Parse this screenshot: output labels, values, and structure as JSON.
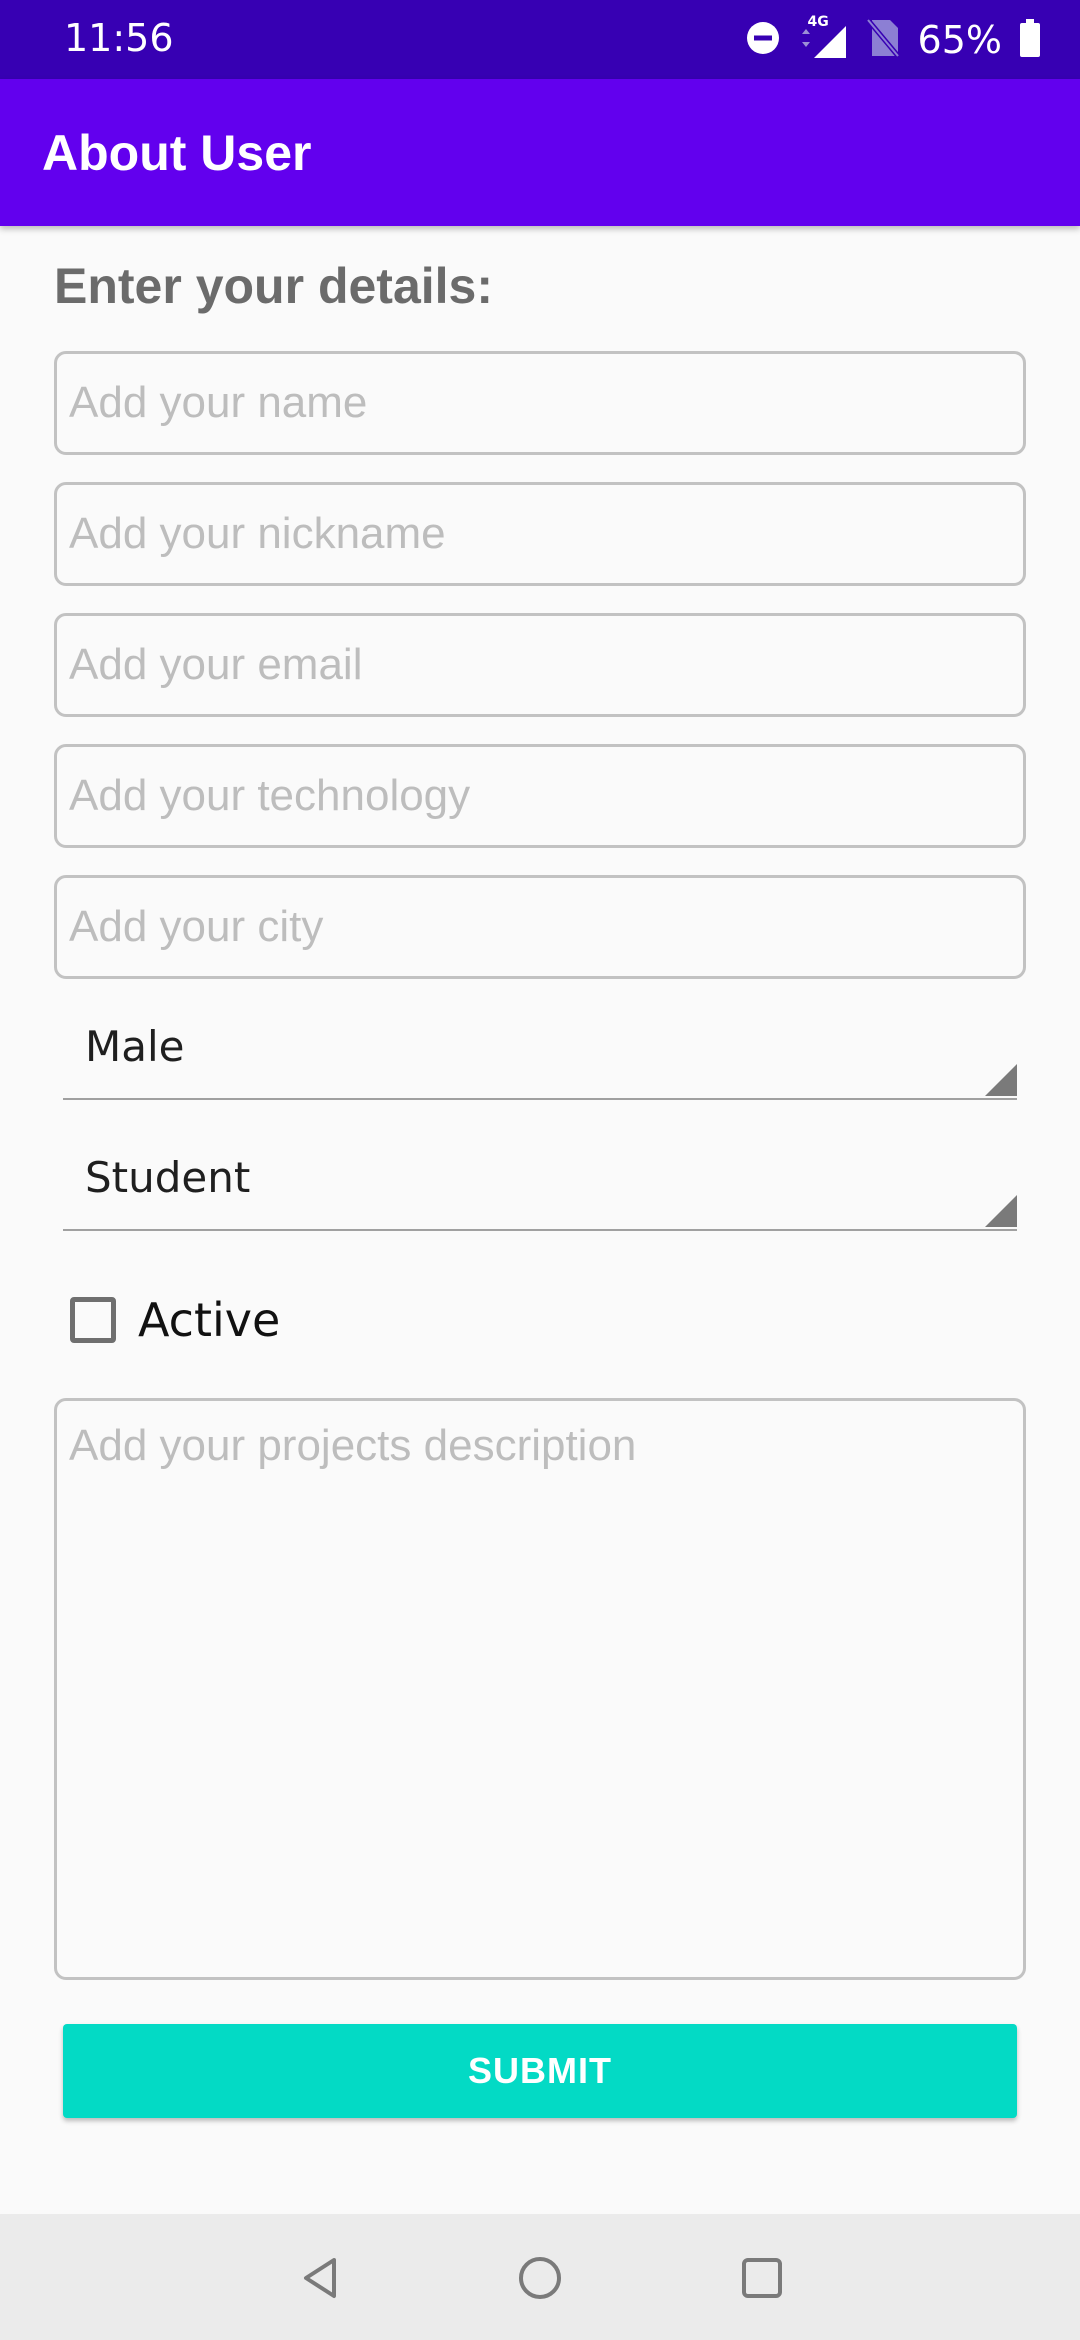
{
  "status_bar": {
    "time": "11:56",
    "network": "4G",
    "battery": "65%",
    "icons": [
      "do-not-disturb-icon",
      "signal-icon",
      "no-sim-icon",
      "battery-icon"
    ]
  },
  "app_bar": {
    "title": "About User",
    "color": "#6200ee"
  },
  "form": {
    "heading": "Enter your details:",
    "name": {
      "placeholder": "Add your name",
      "value": ""
    },
    "nickname": {
      "placeholder": "Add your nickname",
      "value": ""
    },
    "email": {
      "placeholder": "Add your email",
      "value": ""
    },
    "technology": {
      "placeholder": "Add your technology",
      "value": ""
    },
    "city": {
      "placeholder": "Add your city",
      "value": ""
    },
    "gender_spinner": {
      "selected": "Male"
    },
    "role_spinner": {
      "selected": "Student"
    },
    "active_checkbox": {
      "label": "Active",
      "checked": false
    },
    "description": {
      "placeholder": "Add your projects description",
      "value": ""
    },
    "submit_label": "SUBMIT",
    "accent_color": "#03dac5"
  },
  "nav_bar": {
    "icons": [
      "back-icon",
      "home-icon",
      "recents-icon"
    ]
  }
}
